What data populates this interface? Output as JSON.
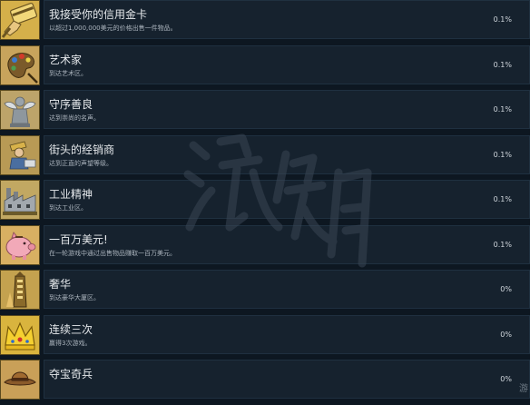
{
  "achievements": [
    {
      "title": "我接受你的信用金卡",
      "description": "以超过1,000,000美元的价格出售一件物品。",
      "percent": "0.1%",
      "icon": "credit-card-hand-icon",
      "icon_bg": "#d5b04a"
    },
    {
      "title": "艺术家",
      "description": "到达艺术区。",
      "percent": "0.1%",
      "icon": "palette-icon",
      "icon_bg": "#c8a45c"
    },
    {
      "title": "守序善良",
      "description": "达到崇尚的名声。",
      "percent": "0.1%",
      "icon": "angel-statue-icon",
      "icon_bg": "#bda46a"
    },
    {
      "title": "街头的经销商",
      "description": "达到正直的声望等级。",
      "percent": "0.1%",
      "icon": "street-dealer-icon",
      "icon_bg": "#b89a55"
    },
    {
      "title": "工业精神",
      "description": "到达工业区。",
      "percent": "0.1%",
      "icon": "factory-icon",
      "icon_bg": "#c2a862"
    },
    {
      "title": "一百万美元!",
      "description": "在一轮游戏中通过出售物品赚取一百万美元。",
      "percent": "0.1%",
      "icon": "piggy-bank-icon",
      "icon_bg": "#d8b062"
    },
    {
      "title": "奢华",
      "description": "到达豪华大厦区。",
      "percent": "0%",
      "icon": "tower-icon",
      "icon_bg": "#c4a24f"
    },
    {
      "title": "连续三次",
      "description": "赢得3次游戏。",
      "percent": "0%",
      "icon": "crown-icon",
      "icon_bg": "#d9b43e"
    },
    {
      "title": "夺宝奇兵",
      "description": "",
      "percent": "0%",
      "icon": "explorer-hat-icon",
      "icon_bg": "#c9a058"
    }
  ],
  "corner_text": "游"
}
